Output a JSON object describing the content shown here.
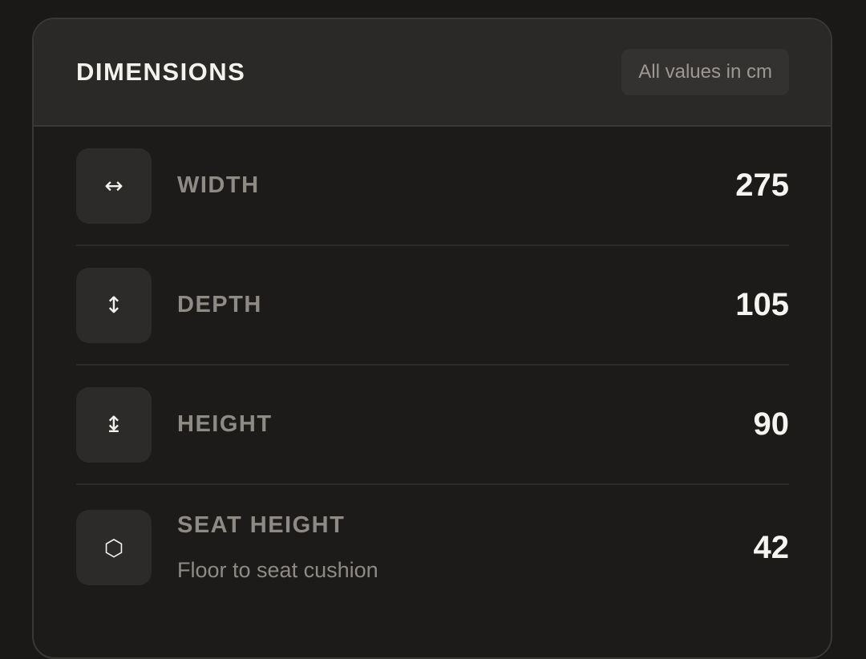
{
  "header": {
    "title": "DIMENSIONS",
    "unit_badge": "All values in cm"
  },
  "rows": [
    {
      "icon": "horizontal-arrows-icon",
      "glyph": "↔",
      "label": "WIDTH",
      "value": "275",
      "sub": ""
    },
    {
      "icon": "vertical-arrows-icon",
      "glyph": "↕",
      "label": "DEPTH",
      "value": "105",
      "sub": ""
    },
    {
      "icon": "height-arrow-icon",
      "glyph": "↨",
      "label": "HEIGHT",
      "value": "90",
      "sub": ""
    },
    {
      "icon": "hexagon-icon",
      "glyph": "⬡",
      "label": "SEAT HEIGHT",
      "value": "42",
      "sub": "Floor to seat cushion"
    }
  ],
  "colors": {
    "background": "#1a1918",
    "card": "#1c1b1a",
    "header": "#2a2927",
    "text_primary": "#f4f2ee",
    "text_muted": "#8e8b85"
  }
}
